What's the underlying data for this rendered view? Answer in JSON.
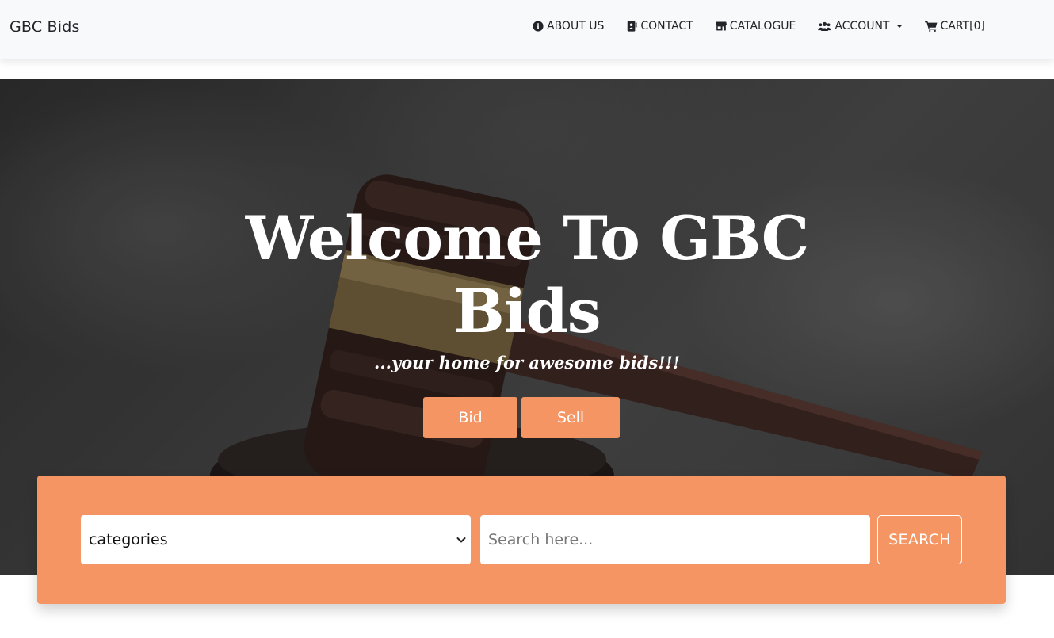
{
  "navbar": {
    "brand": "GBC Bids",
    "items": [
      {
        "label": "ABOUT US",
        "icon": "info-circle-icon"
      },
      {
        "label": "CONTACT",
        "icon": "address-book-icon"
      },
      {
        "label": "CATALOGUE",
        "icon": "store-icon"
      },
      {
        "label": "ACCOUNT",
        "icon": "users-icon"
      },
      {
        "label": "CART[0]",
        "icon": "cart-icon"
      }
    ]
  },
  "hero": {
    "title_line1": "Welcome To GBC",
    "title_line2": "Bids",
    "tagline": "...your home for awesome bids!!!",
    "bid_button": "Bid",
    "sell_button": "Sell"
  },
  "search": {
    "category_selected": "categories",
    "placeholder": "Search here...",
    "button": "SEARCH"
  },
  "colors": {
    "accent": "#f49563",
    "navbar_bg": "#f8f9fa",
    "text_dark": "#212529"
  }
}
